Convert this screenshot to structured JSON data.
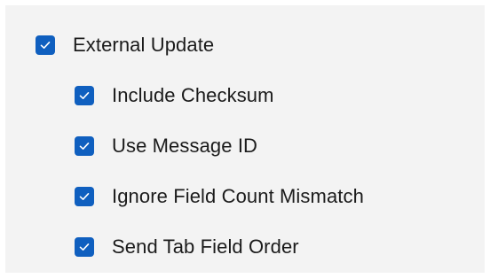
{
  "accent_color": "#0f5fbf",
  "options": {
    "external_update": {
      "label": "External Update",
      "checked": true
    },
    "children": [
      {
        "label": "Include Checksum",
        "checked": true
      },
      {
        "label": "Use Message ID",
        "checked": true
      },
      {
        "label": "Ignore Field Count Mismatch",
        "checked": true
      },
      {
        "label": "Send Tab Field Order",
        "checked": true
      }
    ]
  },
  "icons": {
    "checked_mark": "checkmark-icon"
  }
}
